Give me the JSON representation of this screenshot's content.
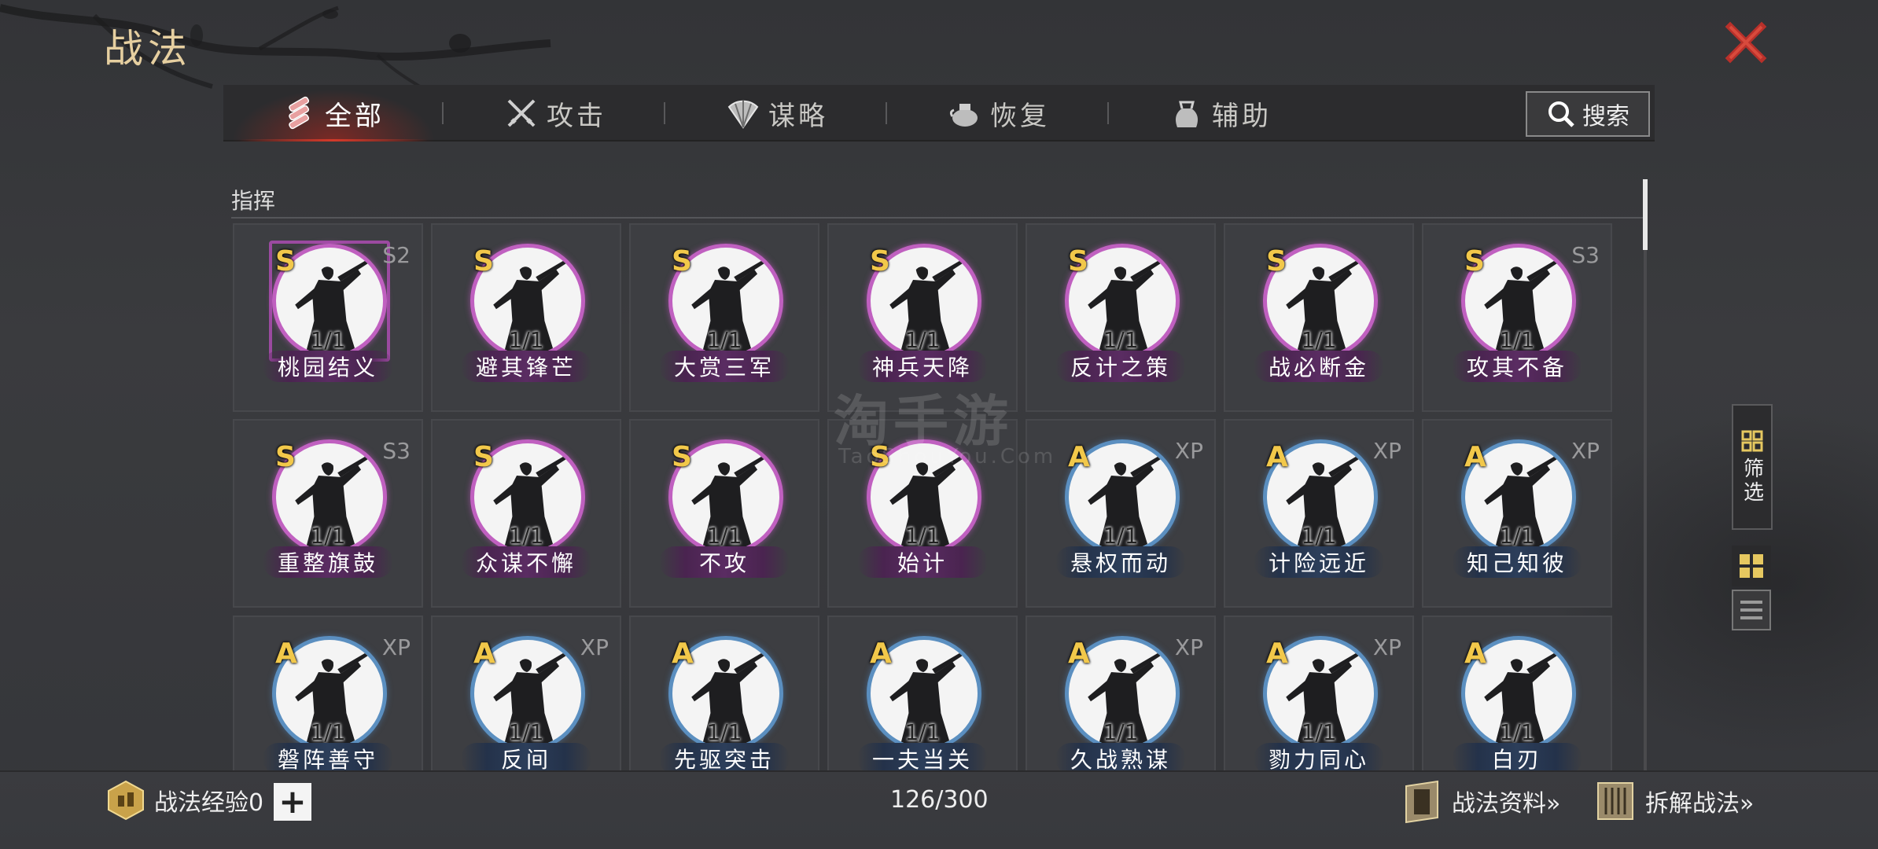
{
  "title": "战法",
  "tabs": [
    {
      "label": "全部",
      "icon": "all-skills-icon",
      "active": true
    },
    {
      "label": "攻击",
      "icon": "crossed-swords-icon",
      "active": false
    },
    {
      "label": "谋略",
      "icon": "strategy-fan-icon",
      "active": false
    },
    {
      "label": "恢复",
      "icon": "recovery-pot-icon",
      "active": false
    },
    {
      "label": "辅助",
      "icon": "support-bag-icon",
      "active": false
    }
  ],
  "search_label": "搜索",
  "section_title": "指挥",
  "watermark": {
    "main": "淘手游",
    "sub": "TaoShouYou.Com"
  },
  "cards": [
    {
      "grade": "S",
      "tag": "S2",
      "count": "1/1",
      "name": "桃园结义",
      "framed": true
    },
    {
      "grade": "S",
      "tag": "",
      "count": "1/1",
      "name": "避其锋芒"
    },
    {
      "grade": "S",
      "tag": "",
      "count": "1/1",
      "name": "大赏三军"
    },
    {
      "grade": "S",
      "tag": "",
      "count": "1/1",
      "name": "神兵天降"
    },
    {
      "grade": "S",
      "tag": "",
      "count": "1/1",
      "name": "反计之策"
    },
    {
      "grade": "S",
      "tag": "",
      "count": "1/1",
      "name": "战必断金"
    },
    {
      "grade": "S",
      "tag": "S3",
      "count": "1/1",
      "name": "攻其不备"
    },
    {
      "grade": "S",
      "tag": "S3",
      "count": "1/1",
      "name": "重整旗鼓"
    },
    {
      "grade": "S",
      "tag": "",
      "count": "1/1",
      "name": "众谋不懈"
    },
    {
      "grade": "S",
      "tag": "",
      "count": "1/1",
      "name": "不攻"
    },
    {
      "grade": "S",
      "tag": "",
      "count": "1/1",
      "name": "始计"
    },
    {
      "grade": "A",
      "tag": "XP",
      "count": "1/1",
      "name": "悬权而动"
    },
    {
      "grade": "A",
      "tag": "XP",
      "count": "1/1",
      "name": "计险远近"
    },
    {
      "grade": "A",
      "tag": "XP",
      "count": "1/1",
      "name": "知己知彼"
    },
    {
      "grade": "A",
      "tag": "XP",
      "count": "1/1",
      "name": "磐阵善守"
    },
    {
      "grade": "A",
      "tag": "XP",
      "count": "1/1",
      "name": "反间"
    },
    {
      "grade": "A",
      "tag": "",
      "count": "1/1",
      "name": "先驱突击"
    },
    {
      "grade": "A",
      "tag": "",
      "count": "1/1",
      "name": "一夫当关"
    },
    {
      "grade": "A",
      "tag": "XP",
      "count": "1/1",
      "name": "久战熟谋"
    },
    {
      "grade": "A",
      "tag": "XP",
      "count": "1/1",
      "name": "勠力同心"
    },
    {
      "grade": "A",
      "tag": "",
      "count": "1/1",
      "name": "白刃"
    }
  ],
  "filter_label": "筛选",
  "bottom": {
    "exp_label": "战法经验0",
    "plus_label": "+",
    "counter": "126/300",
    "info_label": "战法资料»",
    "dismantle_label": "拆解战法»"
  },
  "colors": {
    "accent_red": "#d23a2a",
    "grade_gold": "#f2c84a",
    "s_ring": "#c060c0",
    "a_ring": "#5b8fc0",
    "title_gold": "#e6cfa0"
  }
}
